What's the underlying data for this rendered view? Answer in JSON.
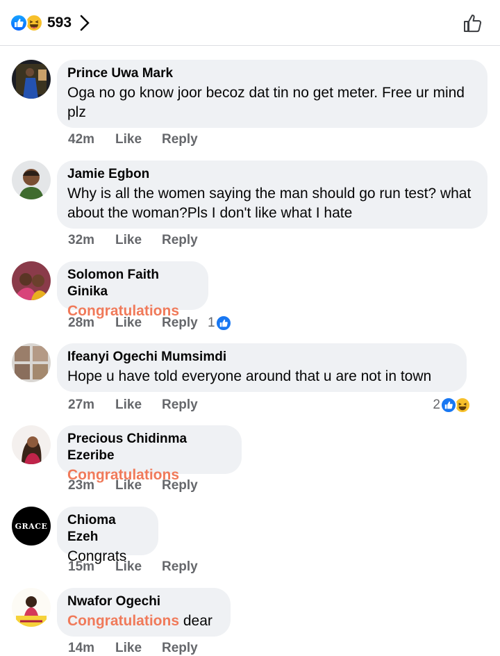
{
  "header": {
    "reaction_count": "593",
    "reaction_icons": [
      "like-icon",
      "haha-icon"
    ],
    "like_button_icon": "thumbs-up-outline-icon"
  },
  "colors": {
    "like_blue": "#1877f2",
    "haha_yellow": "#f7c02b",
    "bubble_bg": "#eff1f4",
    "congrats_text": "#f07a5a",
    "meta_gray": "#65676b"
  },
  "comments": [
    {
      "name": "Prince Uwa Mark",
      "text": "Oga no go know joor becoz dat tin no get meter. Free ur mind plz",
      "time": "42m",
      "like": "Like",
      "reply": "Reply"
    },
    {
      "name": "Jamie Egbon",
      "text": "Why is all the women saying the man should go run test? what about the woman?Pls I don't like what I hate",
      "time": "32m",
      "like": "Like",
      "reply": "Reply"
    },
    {
      "name": "Solomon Faith Ginika",
      "text": "Congratulations",
      "time": "28m",
      "like": "Like",
      "reply": "Reply",
      "reaction_count": "1"
    },
    {
      "name": "Ifeanyi Ogechi Mumsimdi",
      "text": "Hope u have told everyone around that u are not in town",
      "time": "27m",
      "like": "Like",
      "reply": "Reply",
      "reaction_count": "2"
    },
    {
      "name": "Precious Chidinma Ezeribe",
      "text": "Congratulations",
      "time": "23m",
      "like": "Like",
      "reply": "Reply"
    },
    {
      "name": "Chioma Ezeh",
      "text": "Congrats",
      "time": "15m",
      "like": "Like",
      "reply": "Reply",
      "avatar_text": "GRACE"
    },
    {
      "name": "Nwafor Ogechi",
      "text_highlight": "Congratulations",
      "text_rest": " dear",
      "time": "14m",
      "like": "Like",
      "reply": "Reply"
    }
  ]
}
